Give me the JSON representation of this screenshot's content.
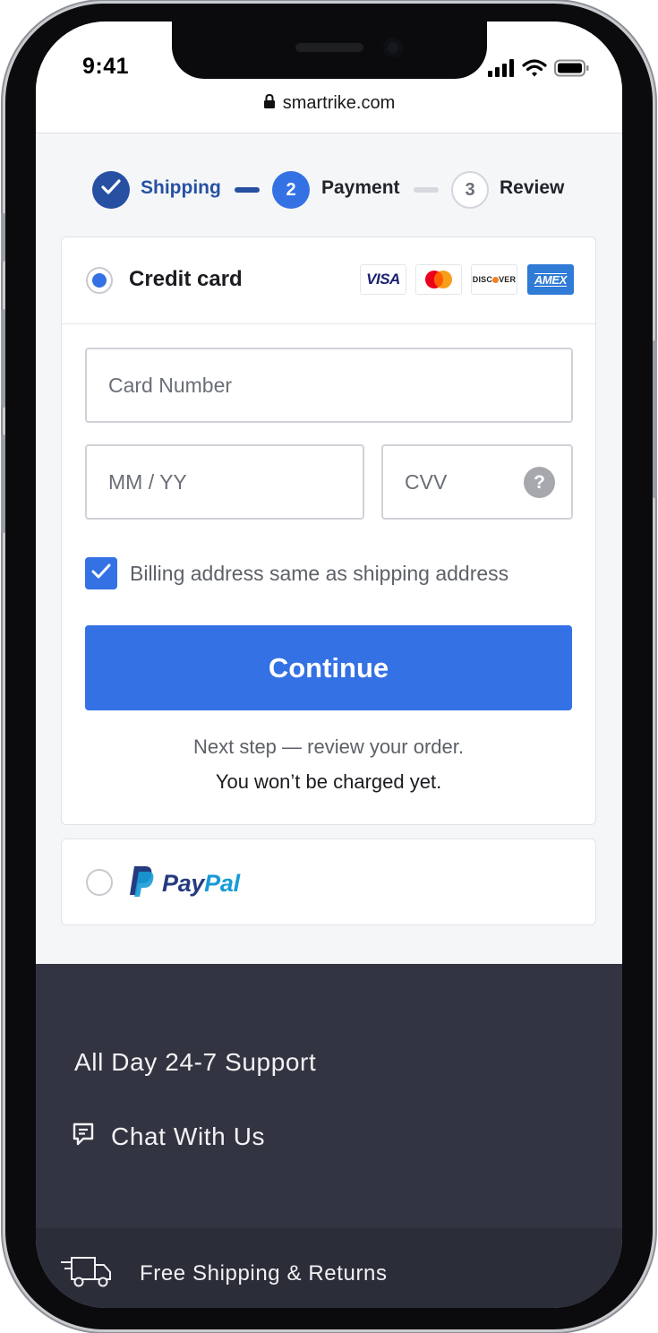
{
  "status_bar": {
    "time": "9:41"
  },
  "browser": {
    "url": "smartrike.com"
  },
  "stepper": {
    "steps": [
      {
        "number": "",
        "label": "Shipping",
        "state": "completed"
      },
      {
        "number": "2",
        "label": "Payment",
        "state": "active"
      },
      {
        "number": "3",
        "label": "Review",
        "state": "upcoming"
      }
    ]
  },
  "payment": {
    "credit_card": {
      "label": "Credit card",
      "selected": true,
      "brands": [
        {
          "name": "VISA",
          "icon": "visa-icon"
        },
        {
          "name": "Mastercard",
          "icon": "mastercard-icon"
        },
        {
          "name": "DISCOVER",
          "icon": "discover-icon"
        },
        {
          "name": "AMEX",
          "icon": "amex-icon"
        }
      ],
      "card_number": {
        "value": "",
        "placeholder": "Card Number"
      },
      "expiry": {
        "value": "",
        "placeholder": "MM / YY"
      },
      "cvv": {
        "value": "",
        "placeholder": "CVV",
        "help": "?"
      },
      "billing_same": {
        "checked": true,
        "label": "Billing address same as shipping address"
      },
      "continue_label": "Continue",
      "next_step_note": "Next step — review your order.",
      "charge_note": "You won’t be charged yet."
    },
    "paypal": {
      "selected": false,
      "label_pay": "Pay",
      "label_pal": "Pal"
    }
  },
  "footer": {
    "support_label": "All Day 24-7 Support",
    "chat_label": "Chat With Us",
    "shipping_label": "Free Shipping & Returns"
  },
  "colors": {
    "accent": "#3471e4",
    "completed": "#2750a3",
    "footer_bg": "#323441",
    "paypal_dark": "#253b80",
    "paypal_light": "#179bd7"
  }
}
